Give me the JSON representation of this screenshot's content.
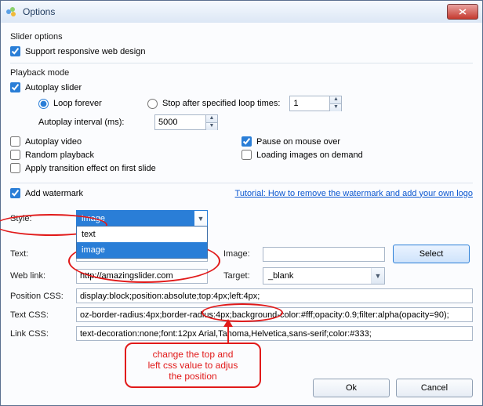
{
  "window": {
    "title": "Options"
  },
  "sections": {
    "slider_options": "Slider options",
    "playback_mode": "Playback mode"
  },
  "slider": {
    "responsive_label": "Support responsive web design"
  },
  "playback": {
    "autoplay_slider": "Autoplay slider",
    "loop_forever": "Loop forever",
    "stop_after": "Stop after specified loop times:",
    "loop_times_value": "1",
    "interval_label": "Autoplay interval (ms):",
    "interval_value": "5000",
    "autoplay_video": "Autoplay video",
    "random_playback": "Random playback",
    "apply_transition": "Apply transition effect on first slide",
    "pause_on_mouse": "Pause on mouse over",
    "loading_on_demand": "Loading images on demand"
  },
  "watermark": {
    "add_watermark": "Add watermark",
    "tutorial_link": "Tutorial: How to remove the watermark and add your own logo",
    "style_label": "Style:",
    "style_selected": "image",
    "style_options": {
      "opt0": "text",
      "opt1": "image"
    },
    "text_label": "Text:",
    "text_value": "",
    "image_label": "Image:",
    "image_value": "",
    "select_btn": "Select",
    "weblink_label": "Web link:",
    "weblink_value": "http://amazingslider.com",
    "target_label": "Target:",
    "target_value": "_blank",
    "position_css_label": "Position CSS:",
    "position_css_value": "display:block;position:absolute;top:4px;left:4px;",
    "text_css_label": "Text CSS:",
    "text_css_value": "oz-border-radius:4px;border-radius:4px;background-color:#fff;opacity:0.9;filter:alpha(opacity=90);",
    "link_css_label": "Link CSS:",
    "link_css_value": "text-decoration:none;font:12px Arial,Tahoma,Helvetica,sans-serif;color:#333;"
  },
  "annotations": {
    "callout_line1": "change the top and",
    "callout_line2": "left css value to adjus",
    "callout_line3": "the position"
  },
  "buttons": {
    "ok": "Ok",
    "cancel": "Cancel"
  }
}
